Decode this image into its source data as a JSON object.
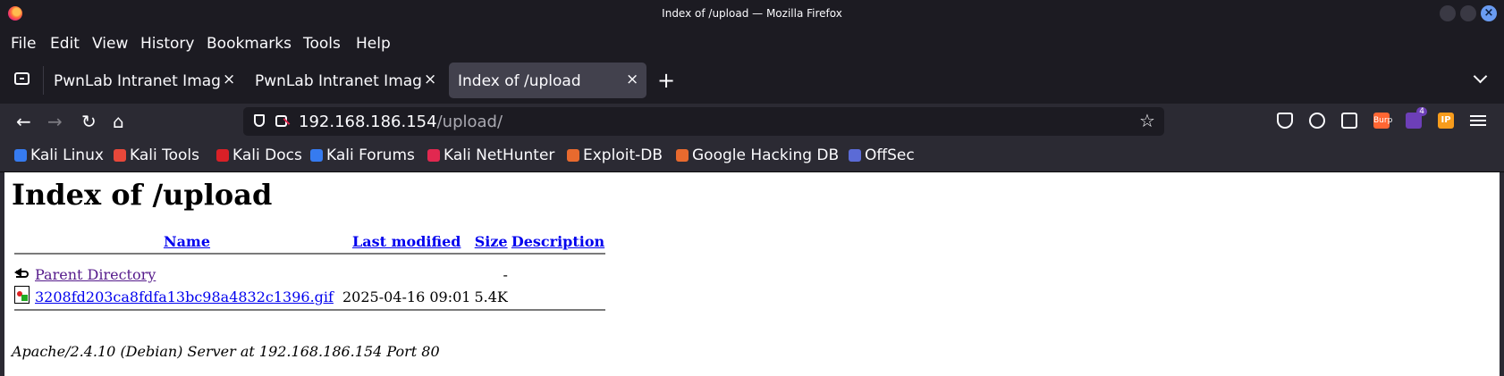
{
  "window": {
    "title": "Index of /upload — Mozilla Firefox"
  },
  "menu": [
    "File",
    "Edit",
    "View",
    "History",
    "Bookmarks",
    "Tools",
    "Help"
  ],
  "tabs": [
    {
      "label": "PwnLab Intranet Image Hosting",
      "active": false
    },
    {
      "label": "PwnLab Intranet Image Hosting",
      "active": false
    },
    {
      "label": "Index of /upload",
      "active": true
    }
  ],
  "urlbar": {
    "host": "192.168.186.154",
    "path": "/upload/"
  },
  "extensions": {
    "burp_label": "Burp",
    "foxy_badge": "4",
    "ip_label": "IP"
  },
  "bookmarks": [
    {
      "label": "Kali Linux",
      "icon": "kali-dragon-icon",
      "color": "#367bf0"
    },
    {
      "label": "Kali Tools",
      "icon": "kali-tools-icon",
      "color": "#e8483a"
    },
    {
      "label": "Kali Docs",
      "icon": "kali-docs-icon",
      "color": "#d92027"
    },
    {
      "label": "Kali Forums",
      "icon": "kali-forums-icon",
      "color": "#367bf0"
    },
    {
      "label": "Kali NetHunter",
      "icon": "nethunter-icon",
      "color": "#e22850"
    },
    {
      "label": "Exploit-DB",
      "icon": "exploitdb-icon",
      "color": "#e86a2e"
    },
    {
      "label": "Google Hacking DB",
      "icon": "ghdb-icon",
      "color": "#e86a2e"
    },
    {
      "label": "OffSec",
      "icon": "offsec-icon",
      "color": "#5b6bd6"
    }
  ],
  "page": {
    "heading": "Index of /upload",
    "columns": {
      "name": "Name",
      "modified": "Last modified",
      "size": "Size",
      "description": "Description"
    },
    "rows": [
      {
        "name": "Parent Directory",
        "modified": "",
        "size": "-",
        "icon": "back-icon"
      },
      {
        "name": "3208fd203ca8fdfa13bc98a4832c1396.gif",
        "modified": "2025-04-16 09:01",
        "size": "5.4K",
        "icon": "image-file-icon"
      }
    ],
    "address": "Apache/2.4.10 (Debian) Server at 192.168.186.154 Port 80"
  }
}
